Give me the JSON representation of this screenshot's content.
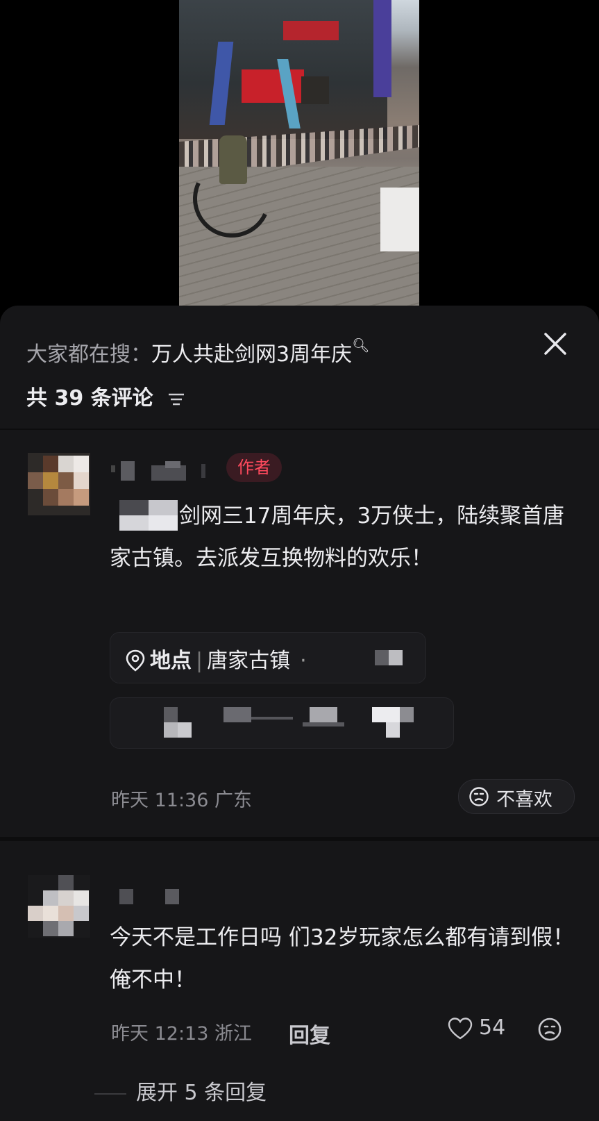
{
  "search": {
    "prefix": "大家都在搜：",
    "term": "万人共赴剑网3周年庆"
  },
  "comments_header": {
    "count_label": "共 39 条评论"
  },
  "comments": [
    {
      "badge": "作者",
      "text": "剑网三17周年庆，3万侠士，陆续聚首唐家古镇。去派发互换物料的欢乐！",
      "location_label": "地点",
      "location_value": "唐家古镇",
      "time": "昨天 11:36",
      "region": "广东",
      "dislike_label": "不喜欢"
    },
    {
      "text": "今天不是工作日吗 们32岁玩家怎么都有请到假！俺不中！",
      "time": "昨天 12:13",
      "region": "浙江",
      "reply_label": "回复",
      "likes": "54",
      "expand_label": "展开 5 条回复"
    }
  ],
  "icons": {
    "close": "close-icon",
    "filter": "filter-icon",
    "location": "location-pin-icon",
    "dislike": "dislike-face-icon",
    "like": "heart-icon"
  }
}
